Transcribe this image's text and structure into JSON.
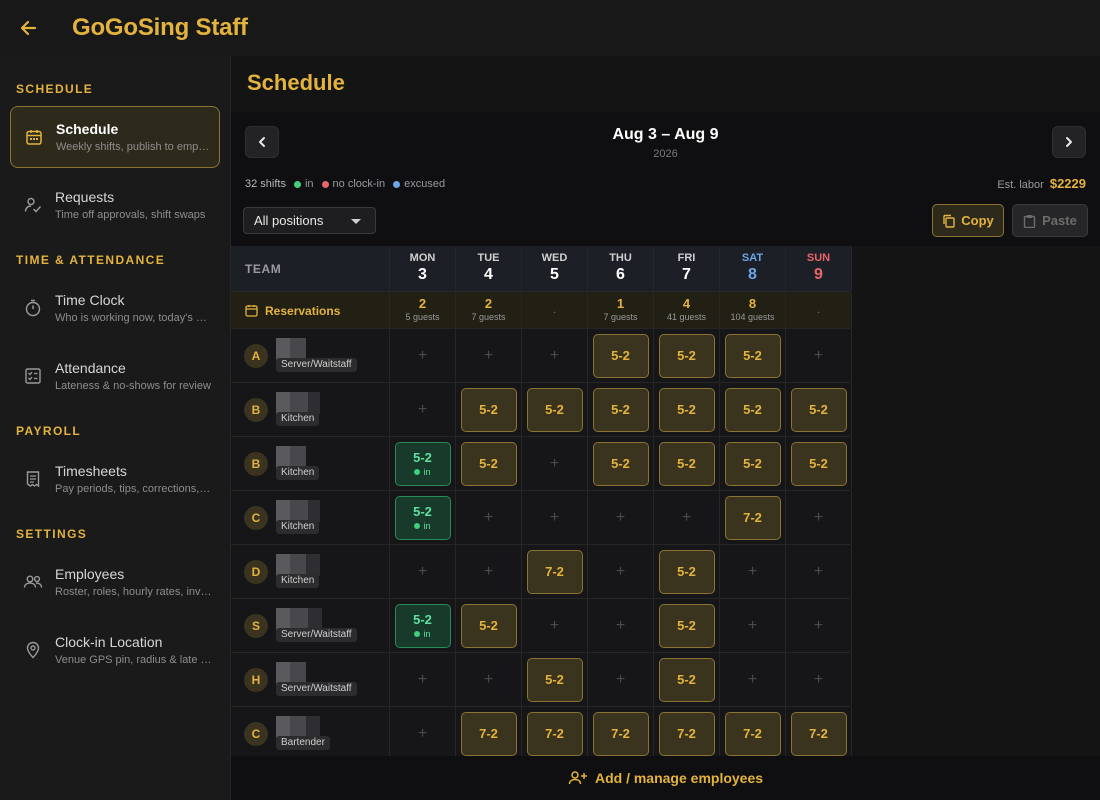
{
  "app": {
    "title": "GoGoSing Staff",
    "back_icon": "arrow-left-icon"
  },
  "sidebar": {
    "sections": [
      {
        "label": "SCHEDULE",
        "items": [
          {
            "title": "Schedule",
            "subtitle": "Weekly shifts, publish to employees",
            "icon": "calendar-icon",
            "active": true
          },
          {
            "title": "Requests",
            "subtitle": "Time off approvals, shift swaps",
            "icon": "user-check-icon",
            "active": false
          }
        ]
      },
      {
        "label": "TIME & ATTENDANCE",
        "items": [
          {
            "title": "Time Clock",
            "subtitle": "Who is working now, today's hours",
            "icon": "stopwatch-icon",
            "active": false
          },
          {
            "title": "Attendance",
            "subtitle": "Lateness & no-shows for review",
            "icon": "checklist-icon",
            "active": false
          }
        ]
      },
      {
        "label": "PAYROLL",
        "items": [
          {
            "title": "Timesheets",
            "subtitle": "Pay periods, tips, corrections, exports",
            "icon": "receipt-icon",
            "active": false
          }
        ]
      },
      {
        "label": "SETTINGS",
        "items": [
          {
            "title": "Employees",
            "subtitle": "Roster, roles, hourly rates, invites",
            "icon": "people-icon",
            "active": false
          },
          {
            "title": "Clock-in Location",
            "subtitle": "Venue GPS pin, radius & late grace",
            "icon": "location-pin-icon",
            "active": false
          }
        ]
      }
    ]
  },
  "main": {
    "page_title": "Schedule",
    "week": {
      "range": "Aug 3 – Aug 9",
      "year": "2026"
    },
    "stats": {
      "shifts": "32 shifts",
      "legend": [
        {
          "label": "in",
          "color": "#3ed07a"
        },
        {
          "label": "no clock-in",
          "color": "#e8666a"
        },
        {
          "label": "excused",
          "color": "#6aa6e8"
        }
      ],
      "labor_label": "Est. labor",
      "labor_value": "$2229"
    },
    "filter": {
      "selected": "All positions"
    },
    "actions": {
      "copy": "Copy",
      "paste": "Paste"
    },
    "grid": {
      "team_header": "TEAM",
      "days": [
        {
          "dow": "MON",
          "num": "3",
          "color": "#cfcfcf"
        },
        {
          "dow": "TUE",
          "num": "4",
          "color": "#cfcfcf"
        },
        {
          "dow": "WED",
          "num": "5",
          "color": "#cfcfcf"
        },
        {
          "dow": "THU",
          "num": "6",
          "color": "#cfcfcf"
        },
        {
          "dow": "FRI",
          "num": "7",
          "color": "#cfcfcf"
        },
        {
          "dow": "SAT",
          "num": "8",
          "color": "#6aa6e8"
        },
        {
          "dow": "SUN",
          "num": "9",
          "color": "#e8666a"
        }
      ],
      "reservations": {
        "label": "Reservations",
        "cells": [
          {
            "count": "2",
            "guests": "5 guests"
          },
          {
            "count": "2",
            "guests": "7 guests"
          },
          {
            "count": "",
            "guests": "",
            "empty": "."
          },
          {
            "count": "1",
            "guests": "7 guests"
          },
          {
            "count": "4",
            "guests": "41 guests"
          },
          {
            "count": "8",
            "guests": "104 guests"
          },
          {
            "count": "",
            "guests": "",
            "empty": "."
          }
        ]
      },
      "employees": [
        {
          "initial": "A",
          "role": "Server/Waitstaff",
          "shifts": [
            "",
            "",
            "",
            "5-2",
            "5-2",
            "5-2",
            ""
          ],
          "in": [
            false,
            false,
            false,
            false,
            false,
            false,
            false
          ]
        },
        {
          "initial": "B",
          "role": "Kitchen",
          "shifts": [
            "",
            "5-2",
            "5-2",
            "5-2",
            "5-2",
            "5-2",
            "5-2"
          ],
          "in": [
            false,
            false,
            false,
            false,
            false,
            false,
            false
          ]
        },
        {
          "initial": "B",
          "role": "Kitchen",
          "shifts": [
            "5-2",
            "5-2",
            "",
            "5-2",
            "5-2",
            "5-2",
            "5-2"
          ],
          "in": [
            true,
            false,
            false,
            false,
            false,
            false,
            false
          ]
        },
        {
          "initial": "C",
          "role": "Kitchen",
          "shifts": [
            "5-2",
            "",
            "",
            "",
            "",
            "7-2",
            ""
          ],
          "in": [
            true,
            false,
            false,
            false,
            false,
            false,
            false
          ]
        },
        {
          "initial": "D",
          "role": "Kitchen",
          "shifts": [
            "",
            "",
            "7-2",
            "",
            "5-2",
            "",
            ""
          ],
          "in": [
            false,
            false,
            false,
            false,
            false,
            false,
            false
          ]
        },
        {
          "initial": "S",
          "role": "Server/Waitstaff",
          "shifts": [
            "5-2",
            "5-2",
            "",
            "",
            "5-2",
            "",
            ""
          ],
          "in": [
            true,
            false,
            false,
            false,
            false,
            false,
            false
          ]
        },
        {
          "initial": "H",
          "role": "Server/Waitstaff",
          "shifts": [
            "",
            "",
            "5-2",
            "",
            "5-2",
            "",
            ""
          ],
          "in": [
            false,
            false,
            false,
            false,
            false,
            false,
            false
          ]
        },
        {
          "initial": "C",
          "role": "Bartender",
          "shifts": [
            "",
            "7-2",
            "7-2",
            "7-2",
            "7-2",
            "7-2",
            "7-2"
          ],
          "in": [
            false,
            false,
            false,
            false,
            false,
            false,
            false
          ]
        }
      ],
      "in_label": "in",
      "empty_slot": "+"
    },
    "footer": {
      "label": "Add / manage employees"
    }
  }
}
